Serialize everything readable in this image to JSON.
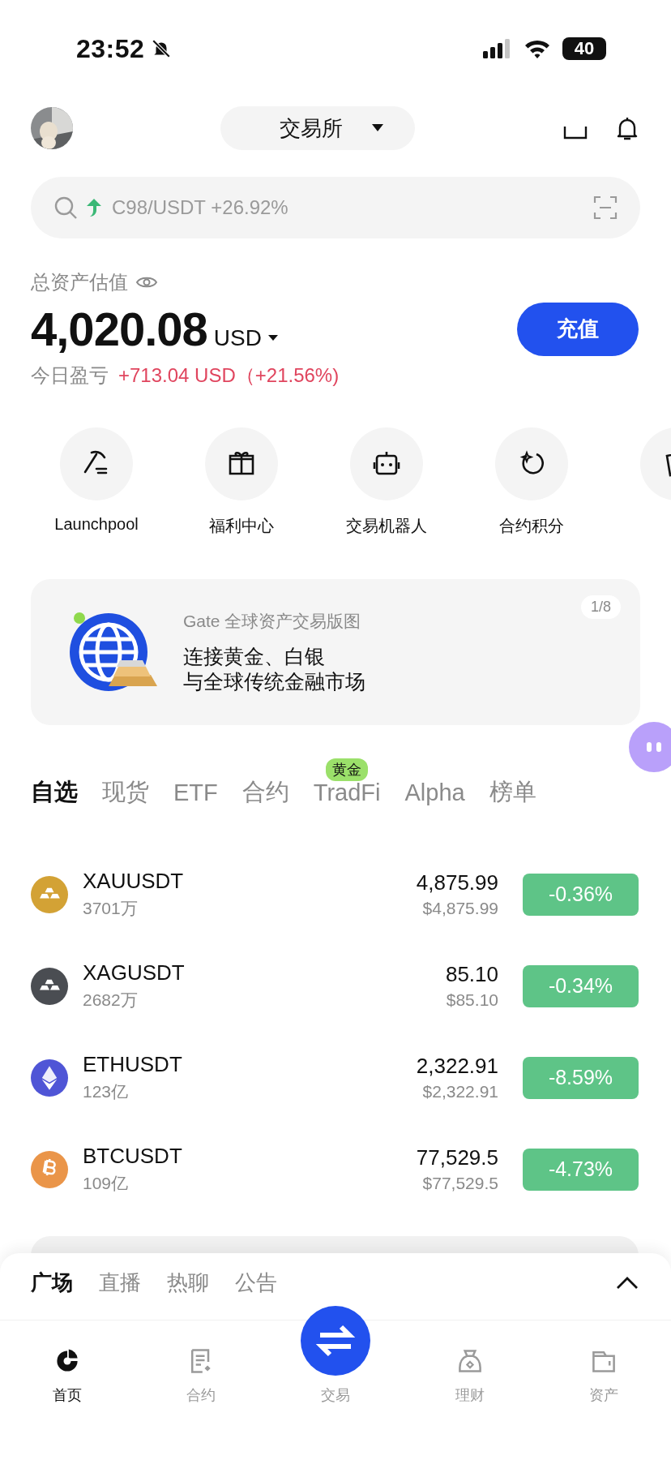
{
  "status_bar": {
    "time": "23:52",
    "battery": "40"
  },
  "header": {
    "exchange_selector": "交易所"
  },
  "search": {
    "placeholder": "C98/USDT +26.92%"
  },
  "assets": {
    "label": "总资产估值",
    "value": "4,020.08",
    "currency": "USD",
    "pnl_label": "今日盈亏",
    "pnl": "+713.04 USD（+21.56%)",
    "deposit_button": "充值"
  },
  "shortcuts": [
    {
      "label": "Launchpool"
    },
    {
      "label": "福利中心"
    },
    {
      "label": "交易机器人"
    },
    {
      "label": "合约积分"
    }
  ],
  "banner": {
    "title": "Gate 全球资产交易版图",
    "lines": [
      "连接黄金、白银",
      "与全球传统金融市场"
    ],
    "counter": "1/8"
  },
  "market_tabs": [
    {
      "label": "自选",
      "selected": true
    },
    {
      "label": "现货",
      "selected": false
    },
    {
      "label": "ETF",
      "selected": false
    },
    {
      "label": "合约",
      "selected": false
    },
    {
      "label": "TradFi",
      "selected": false,
      "badge": "黄金"
    },
    {
      "label": "Alpha",
      "selected": false
    },
    {
      "label": "榜单",
      "selected": false
    }
  ],
  "markets": [
    {
      "symbol": "XAUUSDT",
      "volume": "3701万",
      "price": "4,875.99",
      "price_usd": "$4,875.99",
      "change": "-0.36%",
      "color": "#d3a235"
    },
    {
      "symbol": "XAGUSDT",
      "volume": "2682万",
      "price": "85.10",
      "price_usd": "$85.10",
      "change": "-0.34%",
      "color": "#4a4d52"
    },
    {
      "symbol": "ETHUSDT",
      "volume": "123亿",
      "price": "2,322.91",
      "price_usd": "$2,322.91",
      "change": "-8.59%",
      "color": "#4f55d6"
    },
    {
      "symbol": "BTCUSDT",
      "volume": "109亿",
      "price": "77,529.5",
      "price_usd": "$77,529.5",
      "change": "-4.73%",
      "color": "#ea9549"
    }
  ],
  "sheet_tabs": [
    {
      "label": "广场",
      "selected": true
    },
    {
      "label": "直播",
      "selected": false
    },
    {
      "label": "热聊",
      "selected": false
    },
    {
      "label": "公告",
      "selected": false
    }
  ],
  "nav": [
    {
      "label": "首页",
      "kind": "tab",
      "selected": true
    },
    {
      "label": "合约",
      "kind": "tab",
      "selected": false
    },
    {
      "label": "交易",
      "kind": "center",
      "selected": false
    },
    {
      "label": "理财",
      "kind": "tab",
      "selected": false
    },
    {
      "label": "资产",
      "kind": "tab",
      "selected": false
    }
  ]
}
